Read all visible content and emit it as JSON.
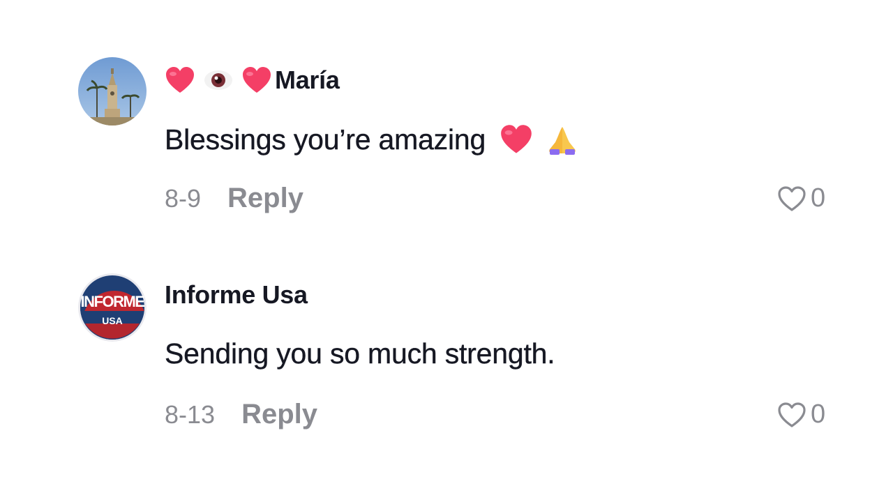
{
  "comments": [
    {
      "username": "María",
      "username_emojis": [
        "red-heart",
        "eye",
        "red-heart"
      ],
      "text": "Blessings you’re amazing",
      "text_emojis": [
        "red-heart",
        "folded-hands"
      ],
      "date": "8-9",
      "reply_label": "Reply",
      "like_count": "0"
    },
    {
      "username": "Informe Usa",
      "avatar_text_top": "INFORME",
      "avatar_text_bottom": "USA",
      "text": "Sending you so much strength.",
      "date": "8-13",
      "reply_label": "Reply",
      "like_count": "0"
    }
  ],
  "colors": {
    "text": "#161823",
    "secondary": "#8a8b91",
    "heart": "#fe2c55"
  }
}
